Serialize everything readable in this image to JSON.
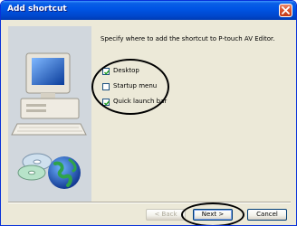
{
  "window": {
    "title": "Add shortcut"
  },
  "instruction": "Specify where to add the shortcut to P-touch AV Editor.",
  "options": [
    {
      "label": "Desktop",
      "checked": true
    },
    {
      "label": "Startup menu",
      "checked": false
    },
    {
      "label": "Quick launch bar",
      "checked": true
    }
  ],
  "buttons": {
    "back_label": "< Back",
    "next_label": "Next >",
    "cancel_label": "Cancel"
  },
  "icons": {
    "close": "close-icon",
    "illustration": "computer-with-cds-and-globe-illustration",
    "check": "checkmark-icon"
  },
  "colors": {
    "title_bar": "#0055e5",
    "dialog_bg": "#ece9d8",
    "close_button": "#d8502b",
    "annotation_circle": "#000000"
  }
}
